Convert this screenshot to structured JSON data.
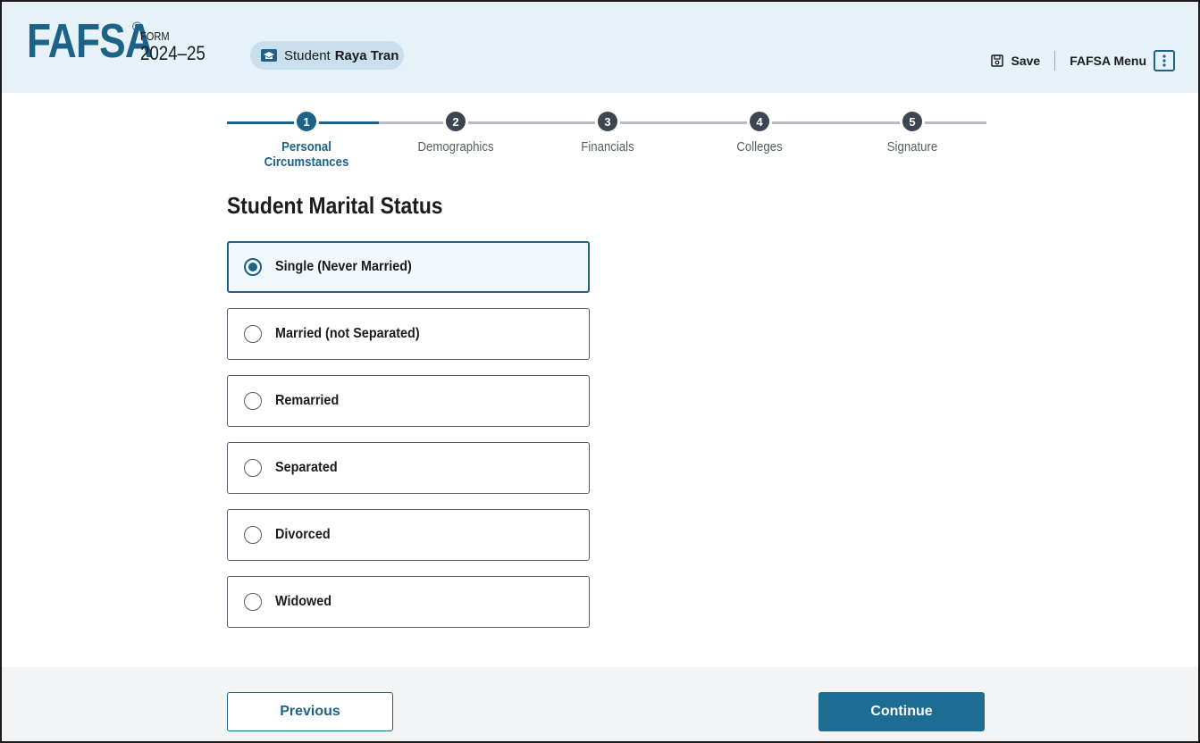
{
  "header": {
    "logo": "FAFSA",
    "logo_mark": "®",
    "form_label": "FORM",
    "form_year": "2024–25",
    "student_prefix": "Student",
    "student_name": "Raya Tran",
    "save_label": "Save",
    "menu_label": "FAFSA Menu"
  },
  "progress": {
    "steps": [
      {
        "number": "1",
        "label": "Personal Circumstances",
        "state": "active"
      },
      {
        "number": "2",
        "label": "Demographics",
        "state": "upcoming"
      },
      {
        "number": "3",
        "label": "Financials",
        "state": "upcoming"
      },
      {
        "number": "4",
        "label": "Colleges",
        "state": "upcoming"
      },
      {
        "number": "5",
        "label": "Signature",
        "state": "upcoming"
      }
    ]
  },
  "page_title": "Student Marital Status",
  "options": [
    {
      "label": "Single (Never Married)",
      "selected": true
    },
    {
      "label": "Married (not Separated)",
      "selected": false
    },
    {
      "label": "Remarried",
      "selected": false
    },
    {
      "label": "Separated",
      "selected": false
    },
    {
      "label": "Divorced",
      "selected": false
    },
    {
      "label": "Widowed",
      "selected": false
    }
  ],
  "footer": {
    "previous_label": "Previous",
    "continue_label": "Continue"
  },
  "colors": {
    "primary": "#1c6387",
    "header_bg": "#e6f1f8",
    "step_inactive": "#3d4551",
    "track_inactive": "#b8bcc2"
  }
}
